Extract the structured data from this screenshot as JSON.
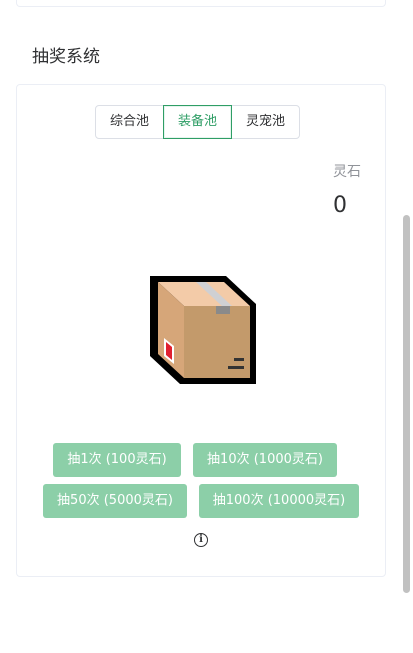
{
  "section_title": "抽奖系统",
  "tabs": [
    {
      "label": "综合池",
      "active": false
    },
    {
      "label": "装备池",
      "active": true
    },
    {
      "label": "灵宠池",
      "active": false
    }
  ],
  "currency": {
    "label": "灵石",
    "value": "0"
  },
  "draw_buttons": [
    {
      "label": "抽1次 (100灵石)"
    },
    {
      "label": "抽10次 (1000灵石)"
    },
    {
      "label": "抽50次 (5000灵石)"
    },
    {
      "label": "抽100次 (10000灵石)"
    }
  ],
  "info_icon": "info-circle-icon",
  "box_icon": "package-box-icon",
  "colors": {
    "accent": "#2f9e66",
    "button": "#8ccfa8"
  }
}
